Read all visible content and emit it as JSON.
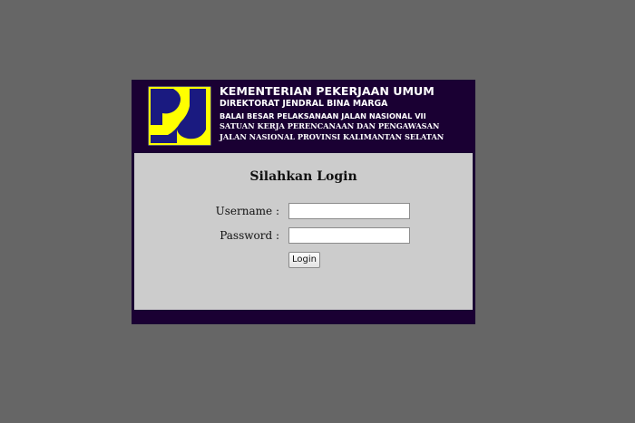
{
  "header": {
    "line1": "KEMENTERIAN PEKERJAAN UMUM",
    "line2": "DIREKTORAT JENDRAL BINA MARGA",
    "line3": "BALAI BESAR PELAKSANAAN JALAN NASIONAL VII",
    "line4": "SATUAN KERJA PERENCANAAN DAN PENGAWASAN",
    "line5": "JALAN NASIONAL PROVINSI KALIMANTAN SELATAN"
  },
  "login": {
    "title": "Silahkan Login",
    "username_label": "Username :",
    "username_value": "",
    "password_label": "Password :",
    "password_value": "",
    "button_label": "Login"
  },
  "colors": {
    "page_background": "#666666",
    "frame_background": "#1a0033",
    "panel_background": "#cccccc",
    "logo_yellow": "#ffff00",
    "logo_navy": "#1a1a80"
  },
  "icons": {
    "logo": "pu-logo-icon"
  }
}
